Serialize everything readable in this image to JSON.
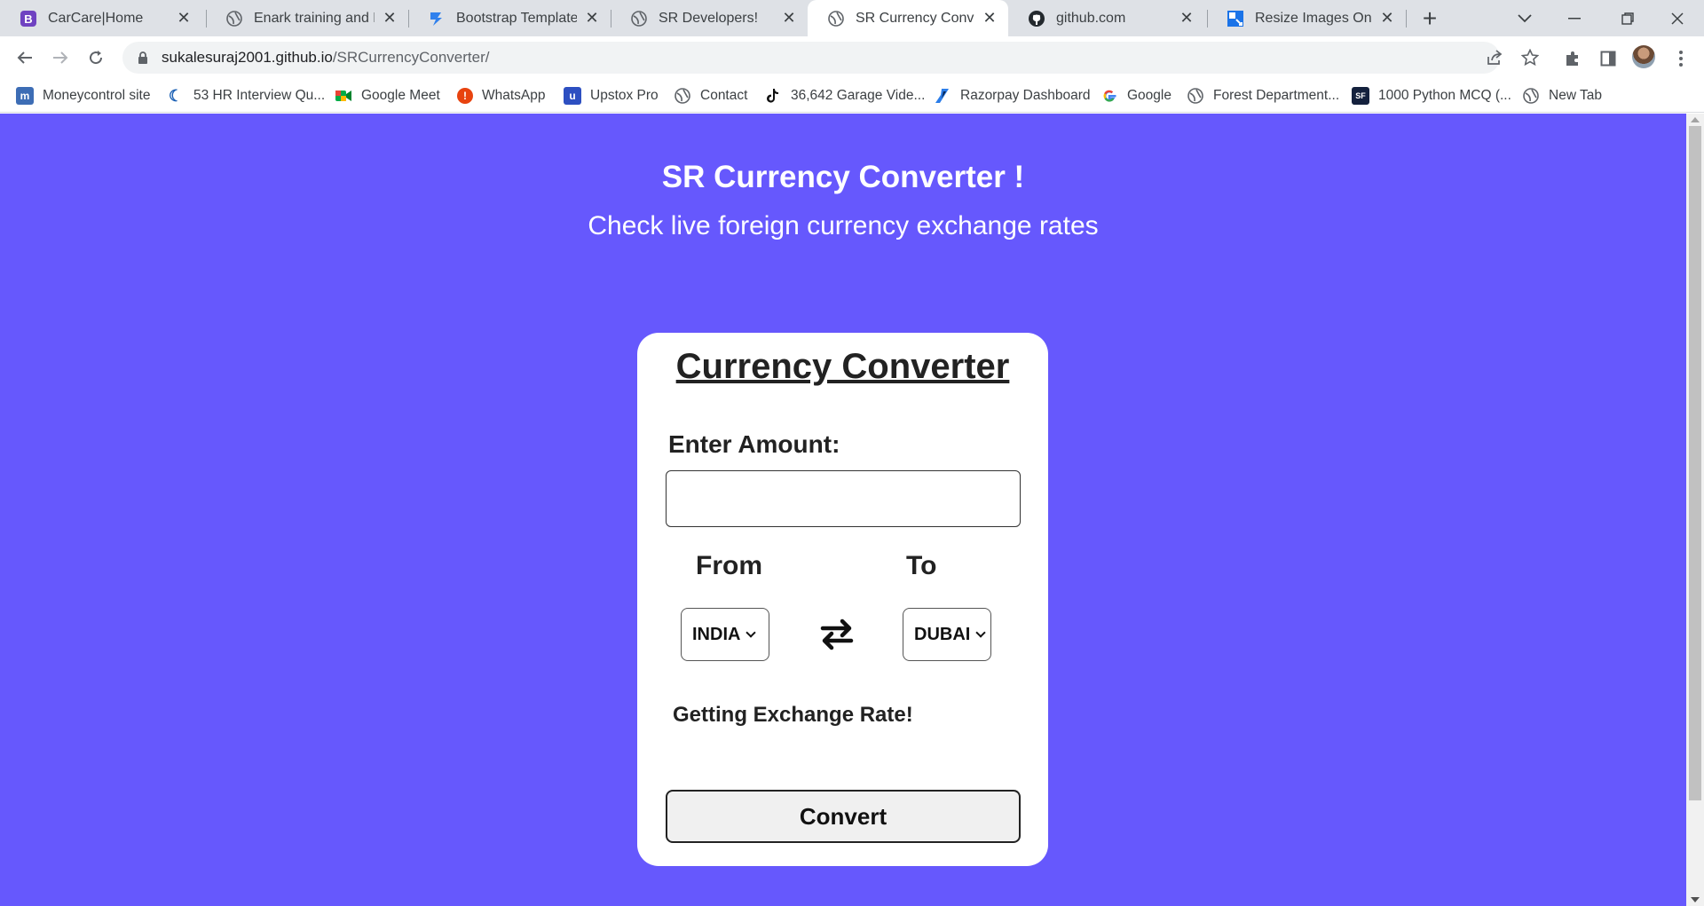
{
  "browser": {
    "tabs": [
      {
        "title": "CarCare|Home",
        "favicon": "bootstrap-b-icon"
      },
      {
        "title": "Enark training and Ma",
        "favicon": "globe-icon"
      },
      {
        "title": "Bootstrap Templates |",
        "favicon": "bootstrap-templates-icon"
      },
      {
        "title": "SR Developers!",
        "favicon": "globe-icon"
      },
      {
        "title": "SR Currency Converte",
        "favicon": "globe-icon",
        "active": true
      },
      {
        "title": "github.com",
        "favicon": "github-icon"
      },
      {
        "title": "Resize Images Online",
        "favicon": "resize-images-icon"
      }
    ],
    "url_host": "sukalesuraj2001.github.io",
    "url_path": "/SRCurrencyConverter/",
    "bookmarks": [
      {
        "label": "Moneycontrol site",
        "favicon": "moneycontrol-icon"
      },
      {
        "label": "53 HR Interview Qu...",
        "favicon": "hr-icon"
      },
      {
        "label": "Google Meet",
        "favicon": "google-meet-icon"
      },
      {
        "label": "WhatsApp",
        "favicon": "whatsapp-icon"
      },
      {
        "label": "Upstox Pro",
        "favicon": "upstox-icon"
      },
      {
        "label": "Contact",
        "favicon": "globe-icon"
      },
      {
        "label": "36,642 Garage Vide...",
        "favicon": "tiktok-icon"
      },
      {
        "label": "Razorpay Dashboard",
        "favicon": "razorpay-icon"
      },
      {
        "label": "Google",
        "favicon": "google-icon"
      },
      {
        "label": "Forest Department...",
        "favicon": "globe-icon"
      },
      {
        "label": "1000 Python MCQ (...",
        "favicon": "sf-icon"
      },
      {
        "label": "New Tab",
        "favicon": "globe-icon"
      }
    ]
  },
  "page": {
    "headline": "SR Currency Converter !",
    "subhead": "Check live foreign currency exchange rates",
    "background_color": "#6658fd",
    "card": {
      "title": "Currency Converter",
      "amount_label": "Enter Amount:",
      "amount_value": "",
      "from_label": "From",
      "to_label": "To",
      "from_selected": "INDIA",
      "to_selected": "DUBAI",
      "status": "Getting Exchange Rate!",
      "convert_label": "Convert"
    }
  }
}
